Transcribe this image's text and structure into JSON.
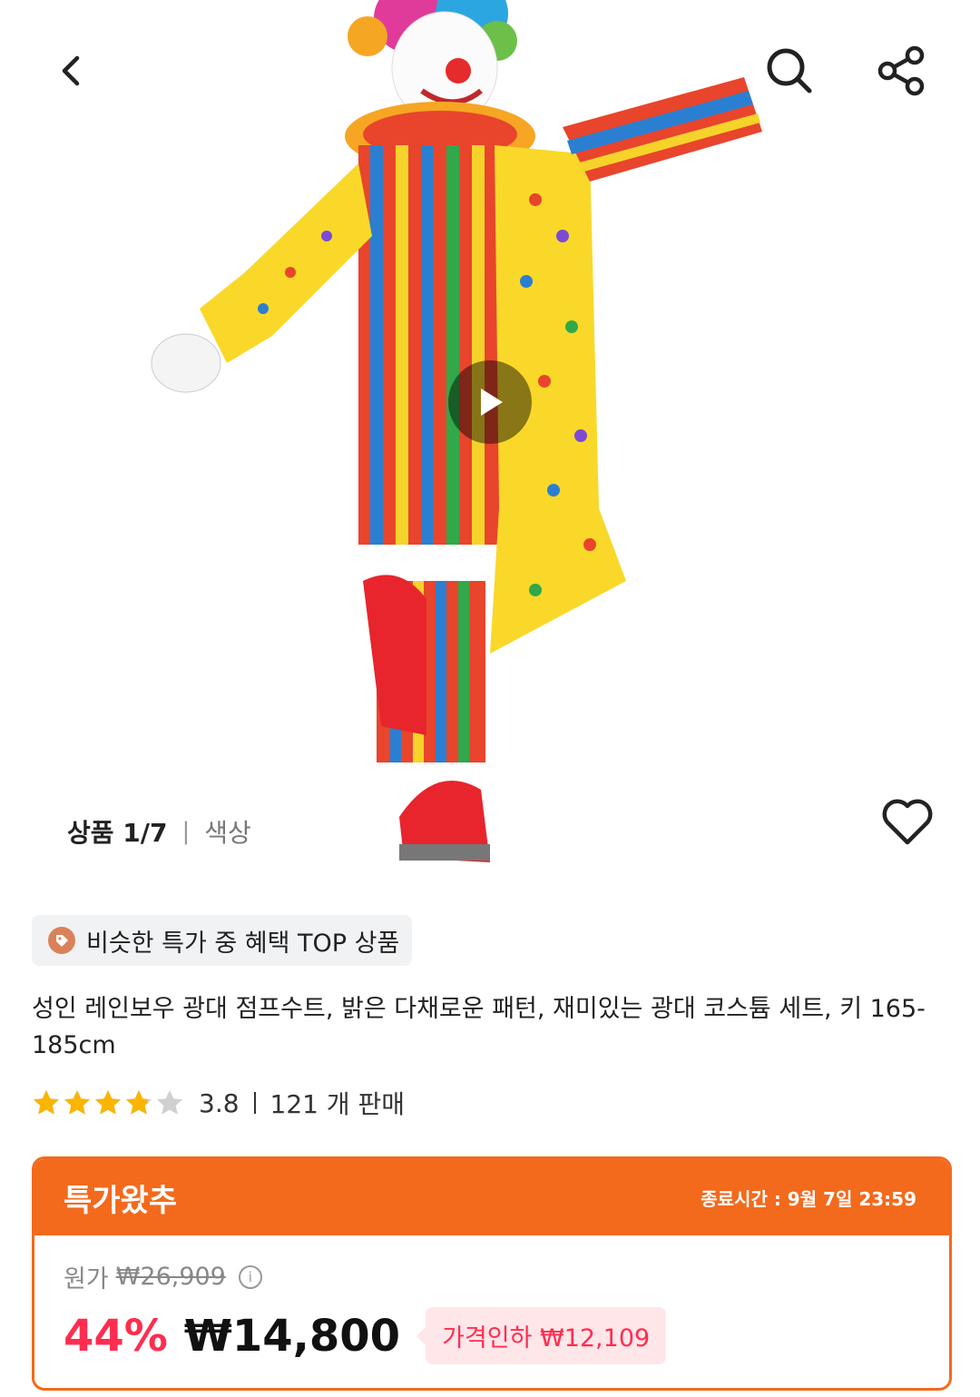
{
  "gallery": {
    "counter": "상품 1/7",
    "variant_label": "색상"
  },
  "icons": {
    "back": "chevron-left-icon",
    "search": "search-icon",
    "share": "share-icon",
    "play": "play-icon",
    "wishlist": "heart-icon",
    "badge": "price-tag-icon",
    "info": "info-icon"
  },
  "badge": {
    "text": "비슷한 특가 중 혜택 TOP 상품"
  },
  "product": {
    "title": "성인 레인보우 광대 점프수트, 밝은 다채로운 패턴, 재미있는 광대 코스튬 세트, 키 165-185cm",
    "rating": "3.8",
    "rating_value": 3.8,
    "sold": "121 개 판매"
  },
  "deal": {
    "title": "특가왔추",
    "end_time": "종료시간 : 9월 7일 23:59",
    "original_label": "원가",
    "original_price": "₩26,909",
    "discount": "44%",
    "price": "₩14,800",
    "price_drop": "가격인하 ₩12,109"
  },
  "colors": {
    "accent": "#f36a1d",
    "discount_red": "#ff2d4f",
    "star": "#f9b500",
    "star_empty": "#d0d0d0"
  }
}
